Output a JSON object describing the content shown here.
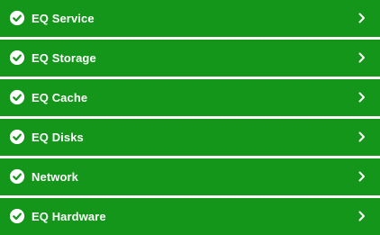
{
  "accent_color": "#13961a",
  "text_color": "#ffffff",
  "items": [
    {
      "label": "EQ Service",
      "status_icon": "check-circle-icon",
      "nav_icon": "chevron-right-icon"
    },
    {
      "label": "EQ Storage",
      "status_icon": "check-circle-icon",
      "nav_icon": "chevron-right-icon"
    },
    {
      "label": "EQ Cache",
      "status_icon": "check-circle-icon",
      "nav_icon": "chevron-right-icon"
    },
    {
      "label": "EQ Disks",
      "status_icon": "check-circle-icon",
      "nav_icon": "chevron-right-icon"
    },
    {
      "label": "Network",
      "status_icon": "check-circle-icon",
      "nav_icon": "chevron-right-icon"
    },
    {
      "label": "EQ Hardware",
      "status_icon": "check-circle-icon",
      "nav_icon": "chevron-right-icon"
    }
  ]
}
